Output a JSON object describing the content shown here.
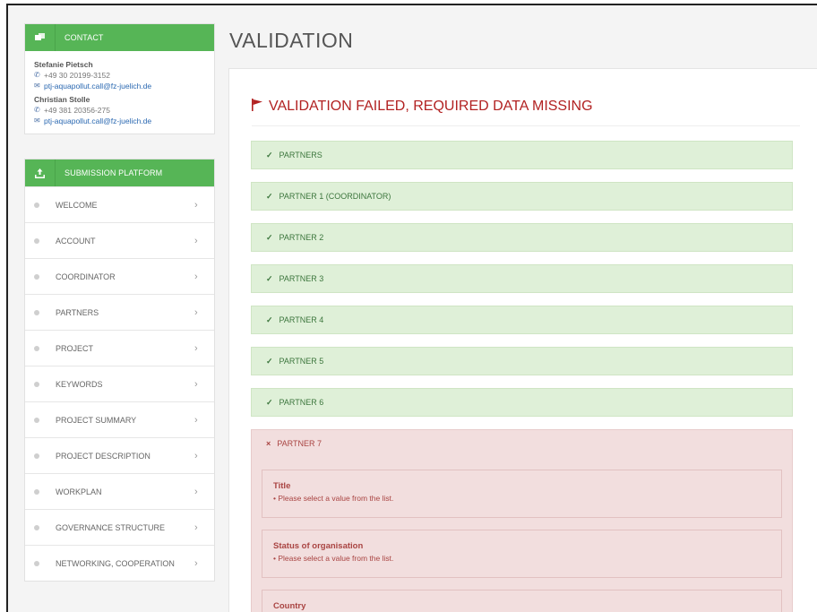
{
  "sidebar": {
    "contact": {
      "title": "CONTACT",
      "people": [
        {
          "name": "Stefanie Pietsch",
          "phone": "+49 30 20199-3152",
          "email": "ptj-aquapollut.call@fz-juelich.de"
        },
        {
          "name": "Christian Stolle",
          "phone": "+49 381 20356-275",
          "email": "ptj-aquapollut.call@fz-juelich.de"
        }
      ]
    },
    "submission": {
      "title": "SUBMISSION PLATFORM",
      "items": [
        {
          "label": "WELCOME"
        },
        {
          "label": "ACCOUNT"
        },
        {
          "label": "COORDINATOR"
        },
        {
          "label": "PARTNERS"
        },
        {
          "label": "PROJECT"
        },
        {
          "label": "KEYWORDS"
        },
        {
          "label": "PROJECT SUMMARY"
        },
        {
          "label": "PROJECT DESCRIPTION"
        },
        {
          "label": "WORKPLAN"
        },
        {
          "label": "GOVERNANCE STRUCTURE"
        },
        {
          "label": "NETWORKING, COOPERATION"
        }
      ]
    }
  },
  "main": {
    "page_title": "VALIDATION",
    "status_title": "VALIDATION FAILED, REQUIRED DATA MISSING",
    "sections": [
      {
        "label": "PARTNERS",
        "status": "ok"
      },
      {
        "label": "PARTNER 1 (COORDINATOR)",
        "status": "ok"
      },
      {
        "label": "PARTNER 2",
        "status": "ok"
      },
      {
        "label": "PARTNER 3",
        "status": "ok"
      },
      {
        "label": "PARTNER 4",
        "status": "ok"
      },
      {
        "label": "PARTNER 5",
        "status": "ok"
      },
      {
        "label": "PARTNER 6",
        "status": "ok"
      },
      {
        "label": "PARTNER 7",
        "status": "error"
      }
    ],
    "errors": [
      {
        "field": "Title",
        "message": "Please select a value from the list."
      },
      {
        "field": "Status of organisation",
        "message": "Please select a value from the list."
      },
      {
        "field": "Country",
        "message": ""
      }
    ]
  },
  "colors": {
    "accent": "#56b556",
    "success_bg": "#dff0d8",
    "error_bg": "#f2dede",
    "error_text": "#a94442"
  },
  "icons": {
    "contact": "contact-card-icon",
    "submission": "upload-icon",
    "flag": "flag-icon",
    "check": "check-icon",
    "cross": "cross-icon",
    "chevron": "chevron-right-icon"
  }
}
